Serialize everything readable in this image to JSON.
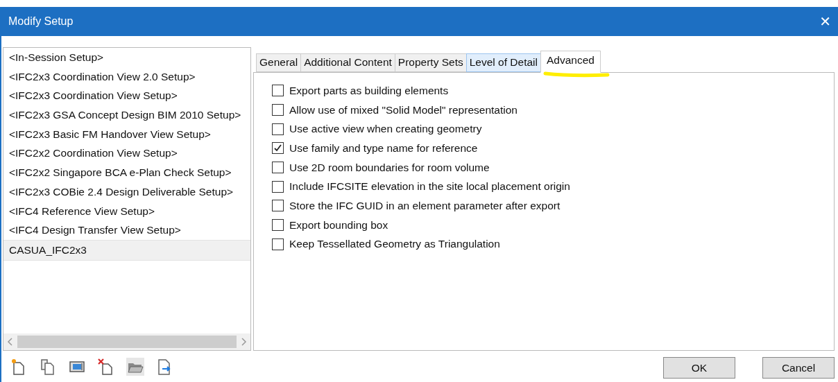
{
  "window": {
    "title": "Modify Setup",
    "close": "✕"
  },
  "setups": [
    {
      "label": "<In-Session Setup>",
      "selected": false
    },
    {
      "label": "<IFC2x3 Coordination View 2.0 Setup>",
      "selected": false
    },
    {
      "label": "<IFC2x3 Coordination View Setup>",
      "selected": false
    },
    {
      "label": "<IFC2x3 GSA Concept Design BIM 2010 Setup>",
      "selected": false
    },
    {
      "label": "<IFC2x3 Basic FM Handover View Setup>",
      "selected": false
    },
    {
      "label": "<IFC2x2 Coordination View Setup>",
      "selected": false
    },
    {
      "label": "<IFC2x2 Singapore BCA e-Plan Check Setup>",
      "selected": false
    },
    {
      "label": "<IFC2x3 COBie 2.4 Design Deliverable Setup>",
      "selected": false
    },
    {
      "label": "<IFC4 Reference View Setup>",
      "selected": false
    },
    {
      "label": "<IFC4 Design Transfer View Setup>",
      "selected": false
    },
    {
      "label": "CASUA_IFC2x3",
      "selected": true
    }
  ],
  "tabs": [
    {
      "label": "General",
      "selected": false,
      "hovered": false
    },
    {
      "label": "Additional Content",
      "selected": false,
      "hovered": false
    },
    {
      "label": "Property Sets",
      "selected": false,
      "hovered": false
    },
    {
      "label": "Level of Detail",
      "selected": false,
      "hovered": true
    },
    {
      "label": "Advanced",
      "selected": true,
      "hovered": false
    }
  ],
  "options": [
    {
      "label": "Export parts as building elements",
      "checked": false
    },
    {
      "label": "Allow use of mixed \"Solid Model\" representation",
      "checked": false
    },
    {
      "label": "Use active view when creating geometry",
      "checked": false
    },
    {
      "label": "Use family and type name for reference",
      "checked": true
    },
    {
      "label": "Use 2D room boundaries for room volume",
      "checked": false
    },
    {
      "label": "Include IFCSITE elevation in the site local placement origin",
      "checked": false
    },
    {
      "label": "Store the IFC GUID in an element parameter after export",
      "checked": false
    },
    {
      "label": "Export bounding box",
      "checked": false
    },
    {
      "label": "Keep Tessellated Geometry as Triangulation",
      "checked": false
    }
  ],
  "toolbar": [
    {
      "kind": "new"
    },
    {
      "kind": "duplicate"
    },
    {
      "kind": "rename"
    },
    {
      "kind": "delete"
    },
    {
      "kind": "open"
    },
    {
      "kind": "export"
    }
  ],
  "buttons": [
    "OK",
    "Cancel"
  ]
}
